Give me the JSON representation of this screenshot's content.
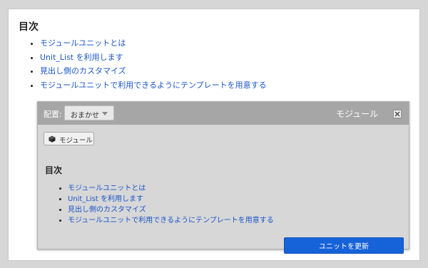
{
  "page": {
    "toc_heading": "目次",
    "toc_items": [
      "モジュールユニットとは",
      "Unit_List を利用します",
      "見出し側のカスタマイズ",
      "モジュールユニットで利用できるようにテンプレートを用意する"
    ]
  },
  "unit_panel": {
    "placement_label": "配置:",
    "placement_selected": "おまかせ",
    "module_title": "モジュール",
    "close_icon": "close-icon",
    "module_tag_label": "モジュール",
    "module_tag_icon": "cube-icon",
    "heading": "目次",
    "items": [
      "モジュールユニットとは",
      "Unit_List を利用します",
      "見出し側のカスタマイズ",
      "モジュールユニットで利用できるようにテンプレートを用意する"
    ],
    "update_button": "ユニットを更新"
  },
  "colors": {
    "link": "#1a55c8",
    "header_bg": "#a6a6a6",
    "panel_bg": "#d7d7d7",
    "primary_button": "#1662d8"
  }
}
